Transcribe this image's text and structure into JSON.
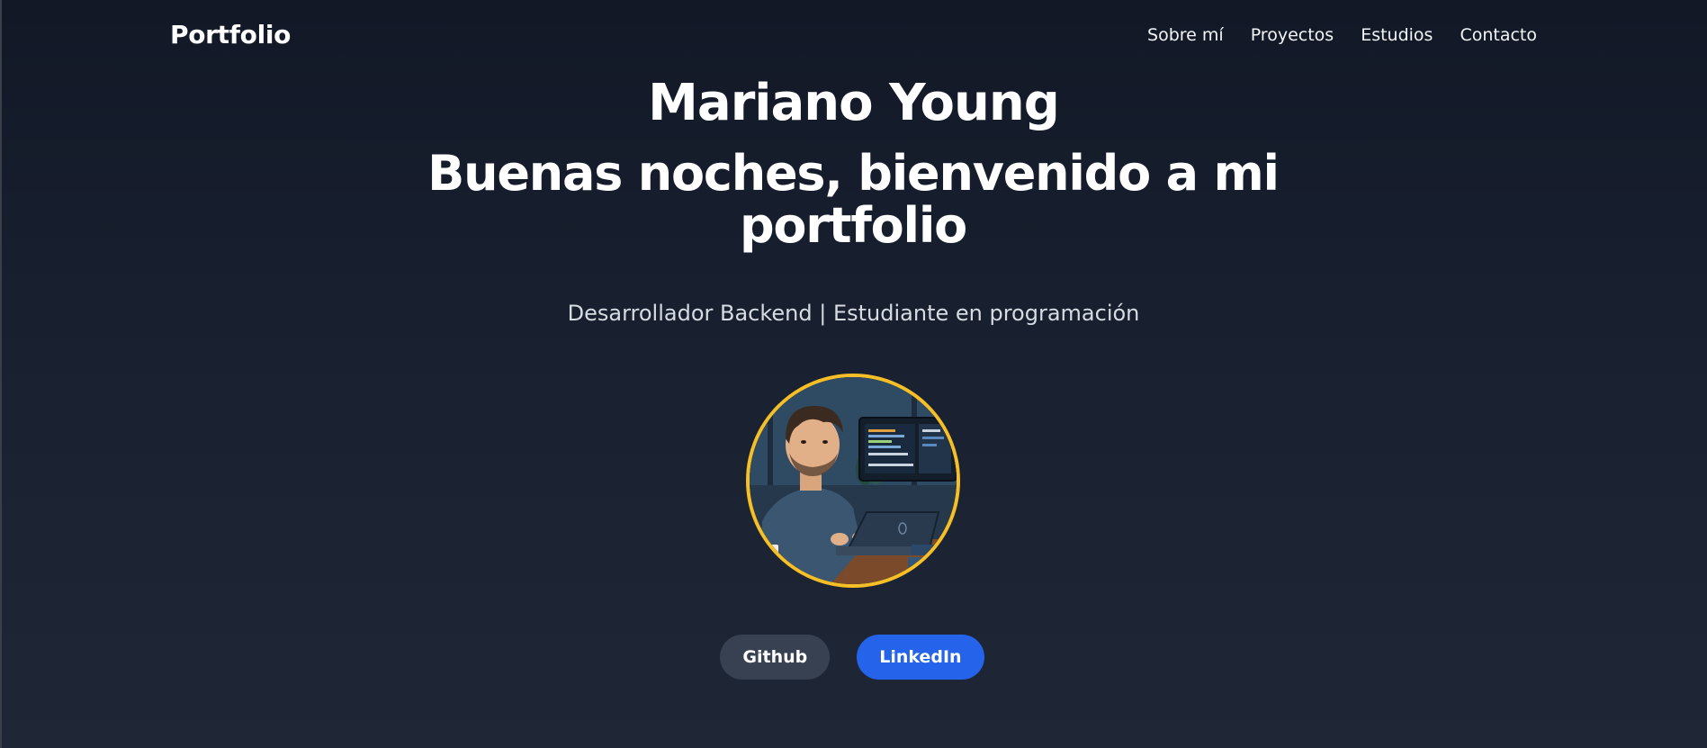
{
  "nav": {
    "brand": "Portfolio",
    "links": [
      {
        "label": "Sobre mí"
      },
      {
        "label": "Proyectos"
      },
      {
        "label": "Estudios"
      },
      {
        "label": "Contacto"
      }
    ]
  },
  "hero": {
    "name": "Mariano Young",
    "greeting_line1": "Buenas noches, bienvenido a mi",
    "greeting_line2": "portfolio",
    "subtitle": "Desarrollador Backend | Estudiante en programación",
    "avatar_alt": "illustrated-developer-at-laptop",
    "avatar_border_color": "#f6bf26"
  },
  "buttons": {
    "github_label": "Github",
    "linkedin_label": "LinkedIn"
  },
  "colors": {
    "background_top": "#121826",
    "background_bottom": "#1f2737",
    "github_button": "#374151",
    "linkedin_button": "#2563eb"
  }
}
